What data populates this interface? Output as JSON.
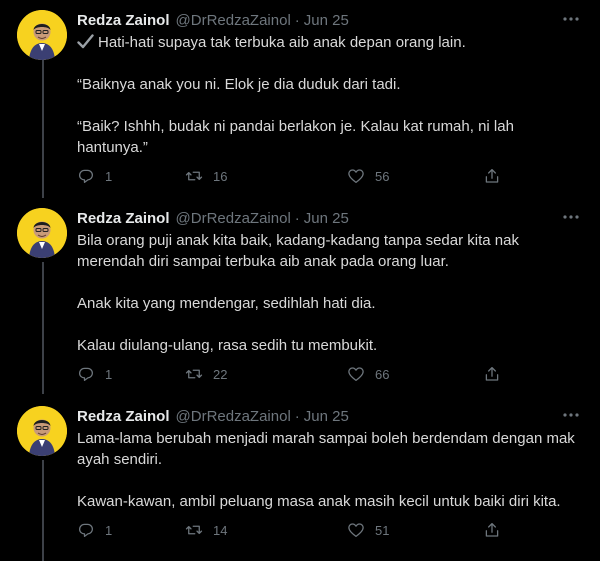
{
  "tweets": [
    {
      "name": "Redza Zainol",
      "handle": "@DrRedzaZainol",
      "date": "Jun 25",
      "paragraphs": [
        "Hati-hati supaya tak terbuka aib anak depan orang lain.",
        "“Baiknya anak you ni. Elok je dia duduk dari tadi.",
        "“Baik? Ishhh, budak ni pandai berlakon je. Kalau kat rumah, ni lah hantunya.”"
      ],
      "lead_icon": "check-mark-icon",
      "replies": "1",
      "retweets": "16",
      "likes": "56"
    },
    {
      "name": "Redza Zainol",
      "handle": "@DrRedzaZainol",
      "date": "Jun 25",
      "paragraphs": [
        "Bila orang puji anak kita baik, kadang-kadang tanpa sedar kita nak merendah diri sampai terbuka aib anak pada orang luar.",
        "Anak kita yang mendengar, sedihlah hati dia.",
        "Kalau diulang-ulang, rasa sedih tu membukit."
      ],
      "replies": "1",
      "retweets": "22",
      "likes": "66"
    },
    {
      "name": "Redza Zainol",
      "handle": "@DrRedzaZainol",
      "date": "Jun 25",
      "paragraphs": [
        "Lama-lama berubah menjadi marah sampai boleh berdendam dengan mak ayah sendiri.",
        "Kawan-kawan, ambil peluang masa anak masih kecil untuk baiki diri kita."
      ],
      "replies": "1",
      "retweets": "14",
      "likes": "51"
    }
  ],
  "separator": "·",
  "colors": {
    "background": "#000000",
    "text": "#d9d9d9",
    "muted": "#6e767d",
    "avatar_bg": "#f7d21f",
    "thread_line": "#3d4148"
  }
}
